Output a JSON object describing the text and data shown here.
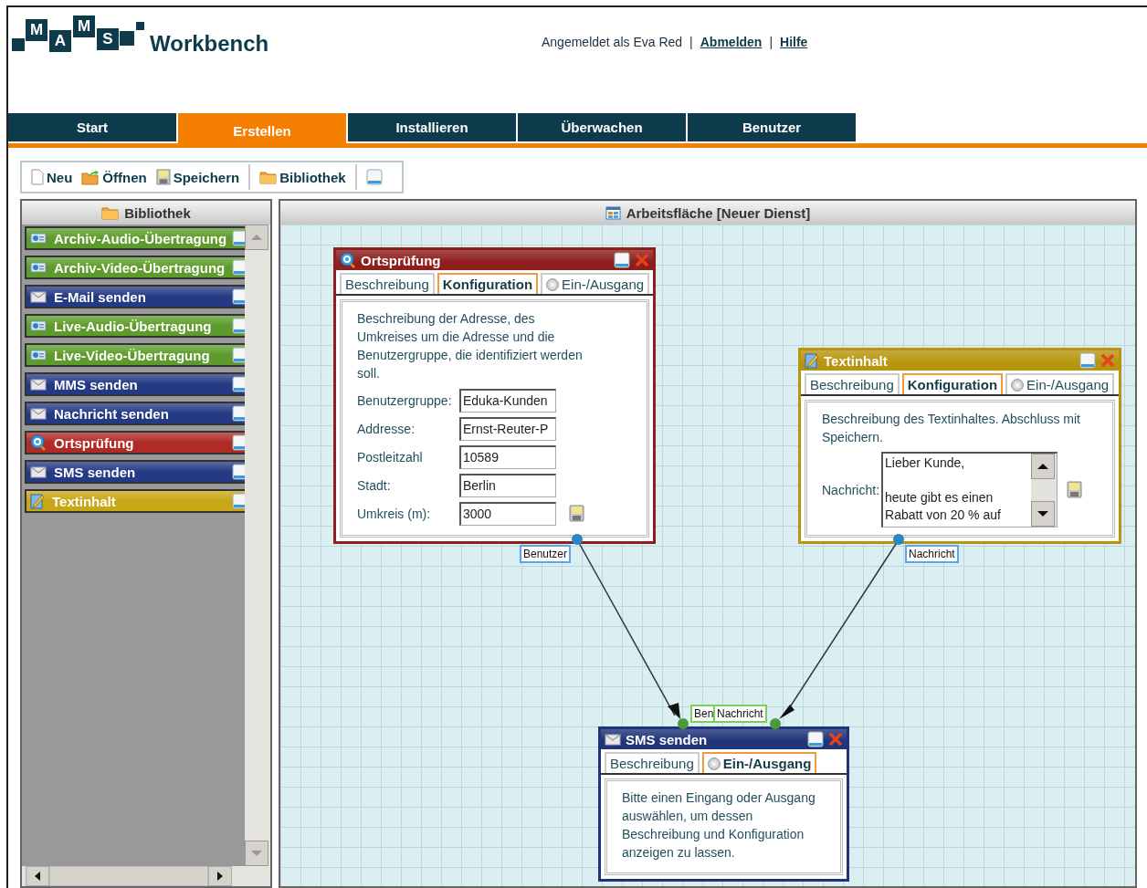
{
  "header": {
    "logo": {
      "letters": [
        "M",
        "A",
        "M",
        "S"
      ],
      "name": "Workbench"
    },
    "user_bar": [
      {
        "kind": "text",
        "text": "Angemeldet als Eva Red"
      },
      {
        "kind": "sep",
        "text": "|"
      },
      {
        "kind": "link",
        "text": "Abmelden"
      },
      {
        "kind": "sep",
        "text": "|"
      },
      {
        "kind": "link",
        "text": "Hilfe"
      }
    ]
  },
  "nav_tabs": [
    {
      "label": "Start",
      "selected": false
    },
    {
      "label": "Erstellen",
      "selected": true
    },
    {
      "label": "Installieren",
      "selected": false
    },
    {
      "label": "Überwachen",
      "selected": false
    },
    {
      "label": "Benutzer",
      "selected": false
    }
  ],
  "toolbar": [
    {
      "kind": "new",
      "label": "Neu"
    },
    {
      "kind": "open",
      "label": "Öffnen"
    },
    {
      "kind": "save",
      "label": "Speichern"
    },
    {
      "kind": "sep"
    },
    {
      "kind": "library",
      "label": "Bibliothek"
    },
    {
      "kind": "sep"
    },
    {
      "kind": "window"
    }
  ],
  "sidebar": {
    "title": "Bibliothek",
    "items": [
      {
        "label": "Archiv-Audio-Übertragung",
        "kind": "media",
        "color": "#5f9b2c"
      },
      {
        "label": "Archiv-Video-Übertragung",
        "kind": "media",
        "color": "#5f9b2c"
      },
      {
        "label": "E-Mail senden",
        "kind": "mail",
        "color": "#243a84"
      },
      {
        "label": "Live-Audio-Übertragung",
        "kind": "media",
        "color": "#5f9b2c"
      },
      {
        "label": "Live-Video-Übertragung",
        "kind": "media",
        "color": "#5f9b2c"
      },
      {
        "label": "MMS senden",
        "kind": "mail",
        "color": "#243a84"
      },
      {
        "label": "Nachricht senden",
        "kind": "mail",
        "color": "#243a84"
      },
      {
        "label": "Ortsprüfung",
        "kind": "location",
        "color": "#b02a26"
      },
      {
        "label": "SMS senden",
        "kind": "mail",
        "color": "#243a84"
      },
      {
        "label": "Textinhalt",
        "kind": "text",
        "color": "#c9a616"
      }
    ]
  },
  "canvas": {
    "title": "Arbeitsfläche [Neuer Dienst]",
    "nodes": [
      {
        "title": "Ortsprüfung",
        "kind": "location",
        "color": "#8e1f1c",
        "tabs": [
          {
            "label": "Beschreibung",
            "kind": "plain",
            "selected": false
          },
          {
            "label": "Konfiguration",
            "kind": "plain",
            "selected": true
          },
          {
            "label": "Ein-/Ausgang",
            "kind": "io",
            "selected": false
          }
        ],
        "description": "Beschreibung der Adresse, des Umkreises um die Adresse und die Benutzergruppe, die identifiziert werden soll.",
        "form": [
          {
            "label": "Benutzergruppe:",
            "value": "Eduka-Kunden"
          },
          {
            "label": "Addresse:",
            "value": "Ernst-Reuter-P"
          },
          {
            "label": "Postleitzahl",
            "value": "10589"
          },
          {
            "label": "Stadt:",
            "value": "Berlin"
          },
          {
            "label": "Umkreis (m):",
            "value": "3000"
          }
        ]
      },
      {
        "title": "Textinhalt",
        "kind": "text",
        "color": "#b8950f",
        "tabs": [
          {
            "label": "Beschreibung",
            "kind": "plain",
            "selected": false
          },
          {
            "label": "Konfiguration",
            "kind": "plain",
            "selected": true
          },
          {
            "label": "Ein-/Ausgang",
            "kind": "io",
            "selected": false
          }
        ],
        "description": "Beschreibung des Textinhaltes. Abschluss mit Speichern.",
        "message": {
          "label": "Nachricht:",
          "value": "Lieber Kunde,\n\nheute gibt es einen\nRabatt von 20 % auf"
        }
      },
      {
        "title": "SMS senden",
        "kind": "mail",
        "color": "#1f3479",
        "tabs": [
          {
            "label": "Beschreibung",
            "kind": "plain",
            "selected": false
          },
          {
            "label": "Ein-/Ausgang",
            "kind": "io",
            "selected": true
          }
        ],
        "description": "Bitte einen Eingang oder Ausgang auswählen, um dessen Beschreibung und Konfiguration anzeigen zu lassen."
      }
    ],
    "port_labels": [
      {
        "text": "Benutzer",
        "kind": "output"
      },
      {
        "text": "Nachricht",
        "kind": "output"
      },
      {
        "text": "Ben",
        "kind": "input"
      },
      {
        "text": "Nachricht",
        "kind": "input"
      }
    ]
  }
}
